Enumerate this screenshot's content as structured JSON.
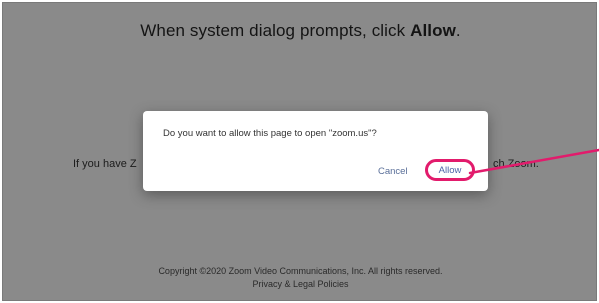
{
  "page": {
    "heading_prefix": "When system dialog prompts, click ",
    "heading_bold": "Allow",
    "heading_suffix": ".",
    "left_text": "If you have Z",
    "right_text": "ch Zoom.",
    "footer_line1": "Copyright ©2020 Zoom Video Communications, Inc. All rights reserved.",
    "footer_line2": "Privacy & Legal Policies"
  },
  "dialog": {
    "message": "Do you want to allow this page to open \"zoom.us\"?",
    "cancel_label": "Cancel",
    "allow_label": "Allow"
  },
  "colors": {
    "background": "#8a8a8a",
    "highlight": "#e21b6c",
    "button_text": "#4a64a8"
  }
}
